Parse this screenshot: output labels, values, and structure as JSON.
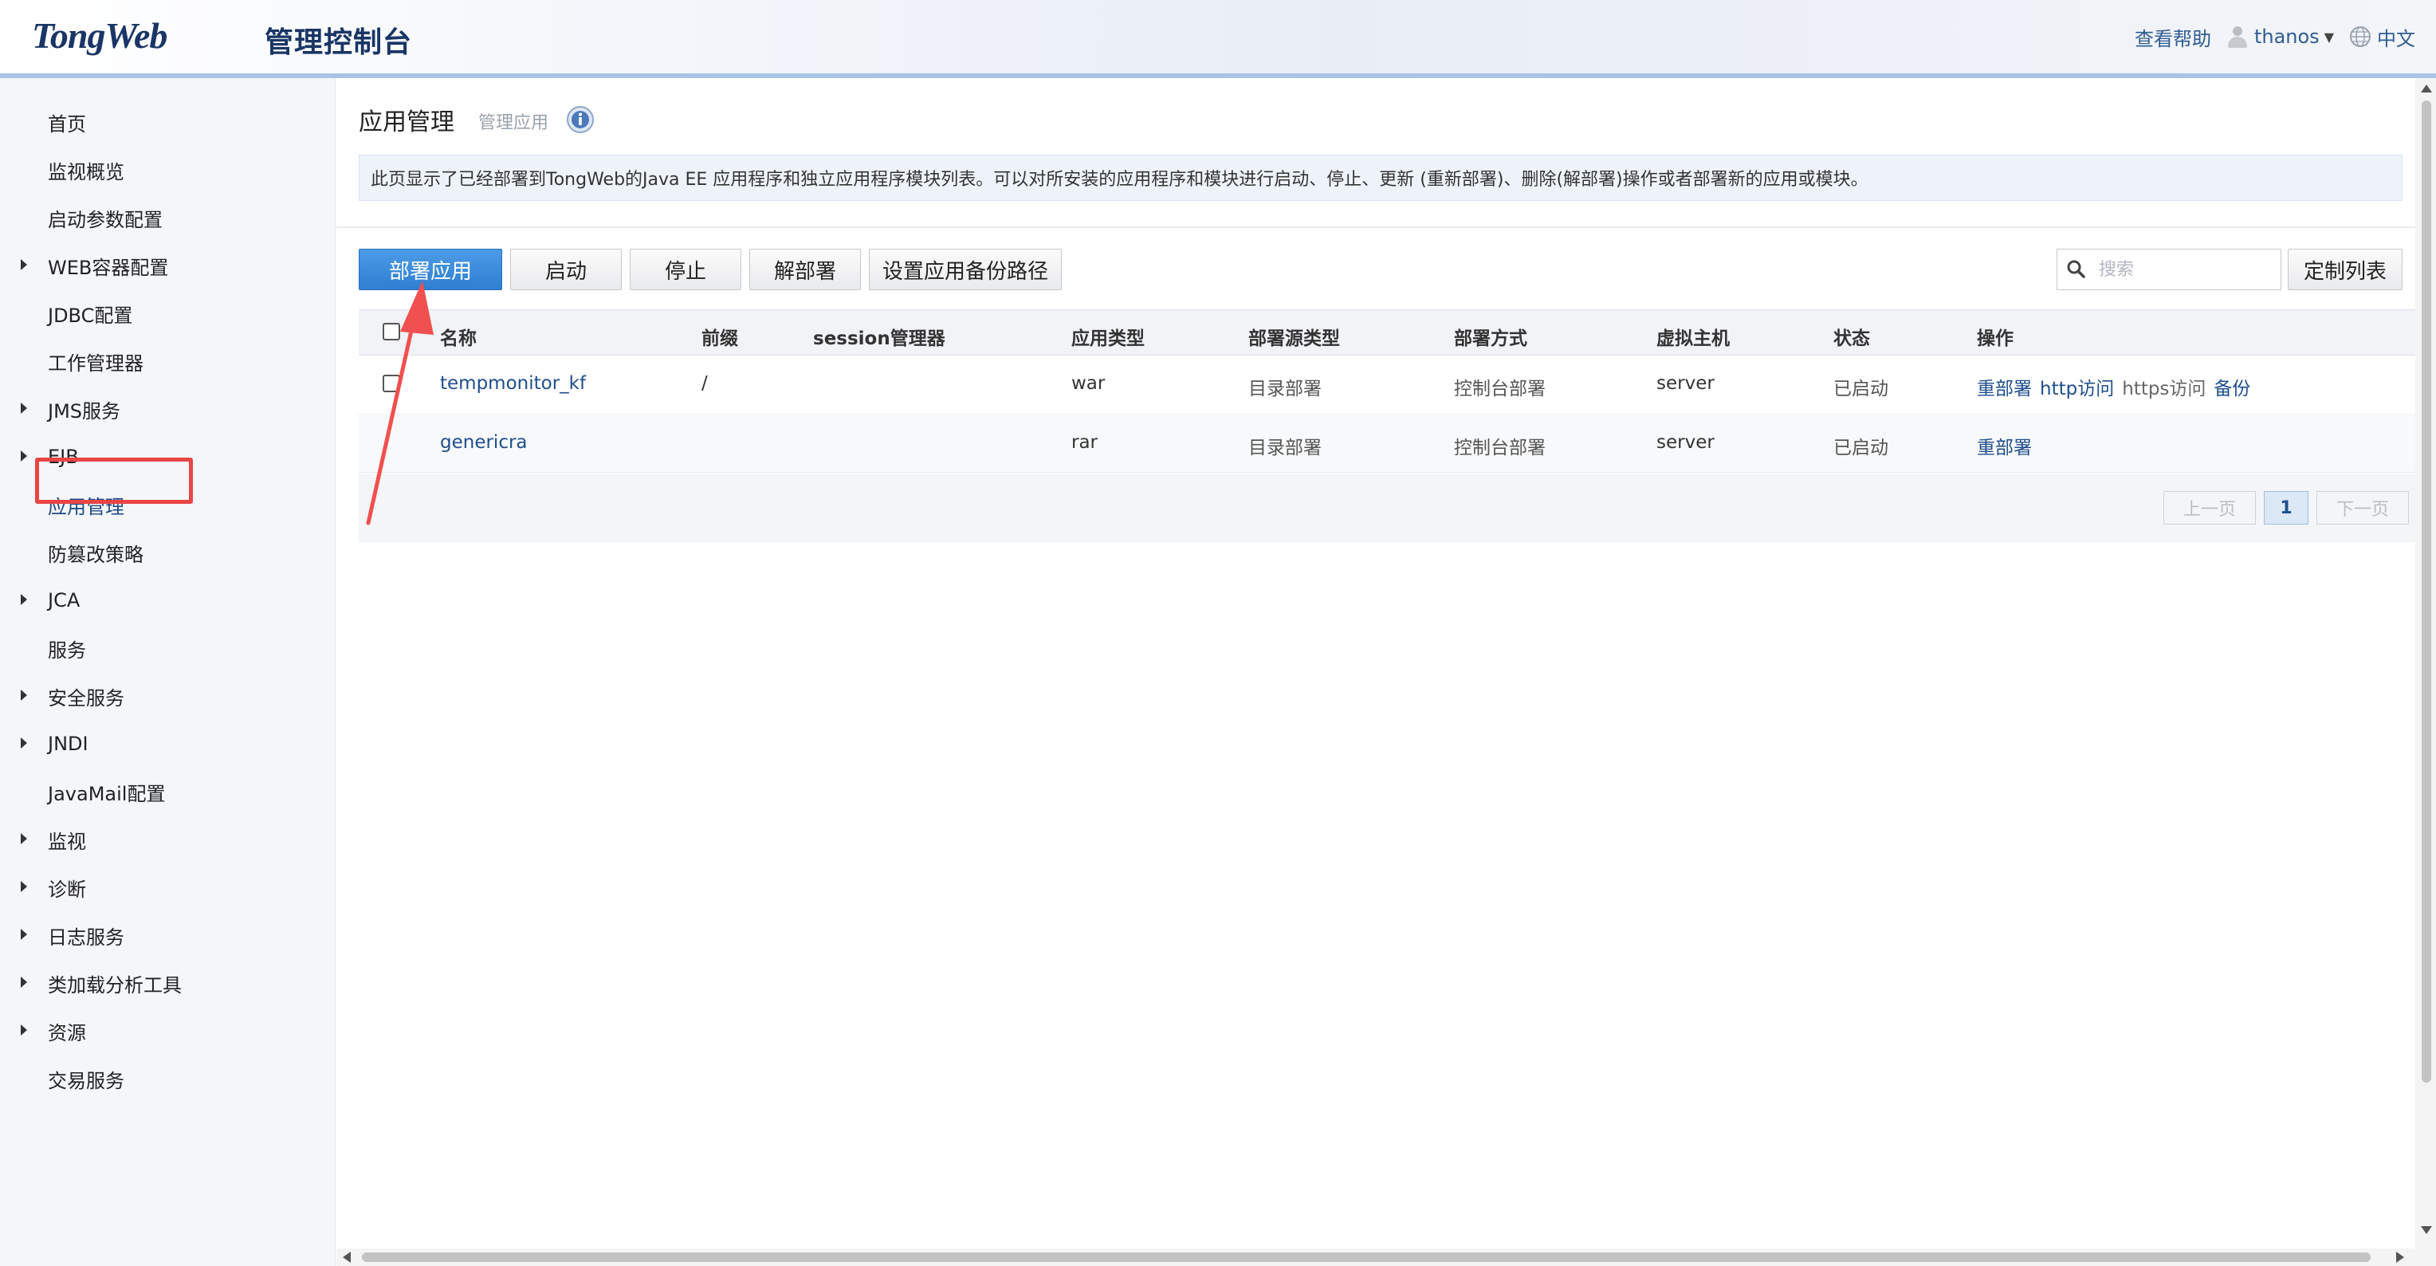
{
  "header": {
    "logo": "TongWeb",
    "logo_sub": "管理控制台",
    "help": "查看帮助",
    "user": "thanos",
    "language": "中文"
  },
  "sidebar": {
    "items": [
      {
        "label": "首页",
        "expandable": false
      },
      {
        "label": "监视概览",
        "expandable": false
      },
      {
        "label": "启动参数配置",
        "expandable": false
      },
      {
        "label": "WEB容器配置",
        "expandable": true
      },
      {
        "label": "JDBC配置",
        "expandable": false
      },
      {
        "label": "工作管理器",
        "expandable": false
      },
      {
        "label": "JMS服务",
        "expandable": true
      },
      {
        "label": "EJB",
        "expandable": true
      },
      {
        "label": "应用管理",
        "expandable": false,
        "active": true
      },
      {
        "label": "防篡改策略",
        "expandable": false
      },
      {
        "label": "JCA",
        "expandable": true
      },
      {
        "label": "服务",
        "expandable": false
      },
      {
        "label": "安全服务",
        "expandable": true
      },
      {
        "label": "JNDI",
        "expandable": true
      },
      {
        "label": "JavaMail配置",
        "expandable": false
      },
      {
        "label": "监视",
        "expandable": true
      },
      {
        "label": "诊断",
        "expandable": true
      },
      {
        "label": "日志服务",
        "expandable": true
      },
      {
        "label": "类加载分析工具",
        "expandable": true
      },
      {
        "label": "资源",
        "expandable": true
      },
      {
        "label": "交易服务",
        "expandable": false
      }
    ]
  },
  "main": {
    "title": "应用管理",
    "subtitle": "管理应用",
    "description": "此页显示了已经部署到TongWeb的Java EE 应用程序和独立应用程序模块列表。可以对所安装的应用程序和模块进行启动、停止、更新 (重新部署)、删除(解部署)操作或者部署新的应用或模块。",
    "toolbar": {
      "deploy": "部署应用",
      "start": "启动",
      "stop": "停止",
      "undeploy": "解部署",
      "backup_path": "设置应用备份路径",
      "search_placeholder": "搜索",
      "customize": "定制列表"
    },
    "table": {
      "columns": [
        "名称",
        "前缀",
        "session管理器",
        "应用类型",
        "部署源类型",
        "部署方式",
        "虚拟主机",
        "状态",
        "操作"
      ],
      "rows": [
        {
          "name": "tempmonitor_kf",
          "prefix": "/",
          "session": "",
          "type": "war",
          "source": "目录部署",
          "method": "控制台部署",
          "host": "server",
          "status": "已启动",
          "ops": {
            "redeploy": "重部署",
            "http_a": "http",
            "http_b": "访问",
            "https_a": "https",
            "https_b": "访问",
            "backup": "备份"
          }
        },
        {
          "name": "genericra",
          "prefix": "",
          "session": "",
          "type": "rar",
          "source": "目录部署",
          "method": "控制台部署",
          "host": "server",
          "status": "已启动",
          "ops": {
            "redeploy": "重部署"
          }
        }
      ]
    },
    "pager": {
      "prev": "上一页",
      "current": "1",
      "next": "下一页"
    }
  },
  "colors": {
    "primary_button": "#3a8ad9",
    "link": "#1f4e8c",
    "highlight_box": "#e84545",
    "annotation_arrow": "#f0504f"
  }
}
